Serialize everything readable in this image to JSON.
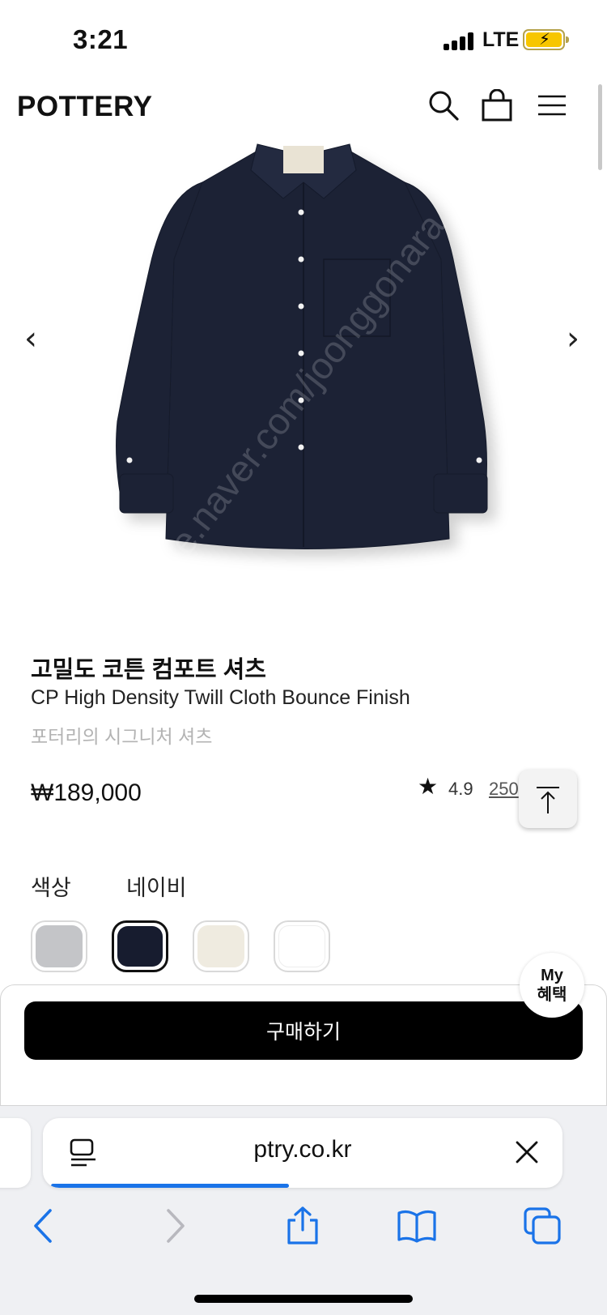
{
  "status_bar": {
    "time": "3:21",
    "network": "LTE",
    "battery_state": "charging",
    "battery_color": "#f7c600"
  },
  "header": {
    "logo": "POTTERY",
    "icons": [
      "search-icon",
      "shopping-bag-icon",
      "menu-icon"
    ]
  },
  "product": {
    "image": "navy long-sleeve shirt photo",
    "image_watermark": "cafe.naver.com/joonggonara",
    "name_ko": "고밀도 코튼 컴포트 셔츠",
    "name_en": "CP High Density Twill Cloth Bounce Finish",
    "subtitle": "포터리의 시그니처 셔츠",
    "price": "₩189,000",
    "rating": "4.9",
    "review_count": "250"
  },
  "colors": {
    "label": "색상",
    "selected_name": "네이비",
    "swatches": [
      {
        "hex": "#c4c5c8",
        "selected": false
      },
      {
        "hex": "#171c2f",
        "selected": true
      },
      {
        "hex": "#efebe0",
        "selected": false
      },
      {
        "hex": "#ffffff",
        "selected": false
      }
    ]
  },
  "purchase": {
    "buy_label": "구매하기",
    "my_benefit_line1": "My",
    "my_benefit_line2": "혜택"
  },
  "browser": {
    "url": "ptry.co.kr",
    "load_progress": 0.42,
    "toolbar": [
      "back-icon",
      "forward-icon",
      "share-icon",
      "bookmarks-icon",
      "tabs-icon"
    ],
    "accent": "#1a73e8"
  }
}
